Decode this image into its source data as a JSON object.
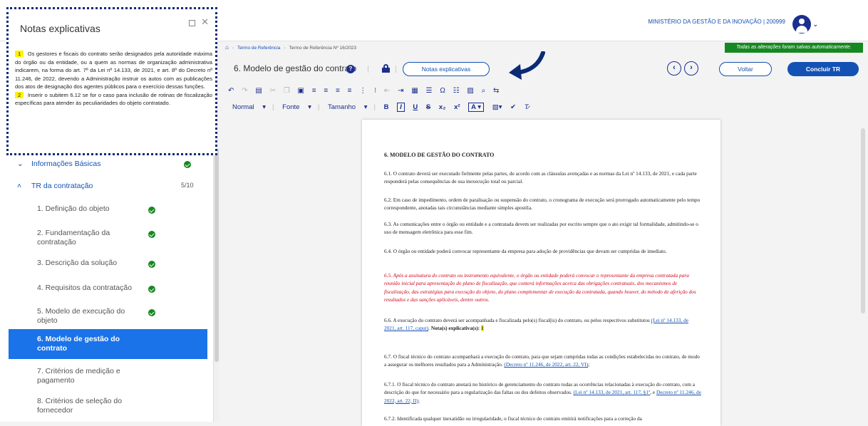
{
  "header": {
    "ministry": "MINISTÉRIO DA GESTÃO E DA INOVAÇÃO | 200999",
    "user_icon": "user-circle-icon"
  },
  "notes_panel": {
    "title": "Notas explicativas",
    "notes": [
      {
        "n": "1",
        "text": "Os gestores e fiscais do contrato serão designados pela autoridade máxima do órgão ou da entidade, ou a quem as normas de organização administrativa indicarem, na forma do art. 7º da Lei nº 14.133, de 2021, e art. 8º do Decreto nº 11.246, de 2022, devendo a Administração instruir os autos com as publicações dos atos de designação dos agentes públicos para o exercício dessas funções."
      },
      {
        "n": "2",
        "text": "Inserir o subitem 6.12 se for o caso para inclusão de rotinas de fiscalização específicas para atender às peculiaridades do objeto contratado."
      }
    ]
  },
  "sidebar": {
    "group_basic": {
      "label": "Informações Básicas"
    },
    "group_tr": {
      "label": "TR da contratação",
      "count": "5/10"
    },
    "items": [
      {
        "label": "1. Definição do objeto"
      },
      {
        "label": "2. Fundamentação da contratação"
      },
      {
        "label": "3. Descrição da solução"
      },
      {
        "label": "4. Requisitos da contratação"
      },
      {
        "label": "5. Modelo de execução do objeto"
      },
      {
        "label": "6. Modelo de gestão do contrato"
      },
      {
        "label": "7. Critérios de medição e pagamento"
      },
      {
        "label": "8. Critérios de seleção do fornecedor"
      }
    ]
  },
  "breadcrumb": {
    "home_icon": "home-icon",
    "crumbs": [
      "Termo de Referência",
      "Termo de Referência Nº 16/2023"
    ]
  },
  "saved_badge": "Todas as alterações foram salvas automaticamente.",
  "section_header": {
    "title": "6. Modelo de gestão do contrato",
    "notes_button": "Notas explicativas",
    "back_button": "Voltar",
    "finish_button": "Concluir TR"
  },
  "editor_toolbar": {
    "format": "Normal",
    "font": "Fonte",
    "size": "Tamanho"
  },
  "document": {
    "heading": "6. MODELO DE GESTÃO DO CONTRATO",
    "p1": "6.1. O contrato deverá ser executado fielmente pelas partes, de acordo com as cláusulas avençadas e as normas da Lei nº 14.133, de 2021, e cada parte responderá pelas consequências de sua inexecução total ou parcial.",
    "p2": "6.2. Em caso de impedimento, ordem de paralisação ou suspensão do contrato, o cronograma de execução será prorrogado automaticamente pelo tempo correspondente, anotadas tais circunstâncias mediante simples apostila.",
    "p3": "6.3. As comunicações entre o órgão ou entidade e a contratada devem ser realizadas por escrito sempre que o ato exigir tal formalidade, admitindo-se o uso de mensagem eletrônica para esse fim.",
    "p4": "6.4. O órgão ou entidade poderá convocar representante da empresa para adoção de providências que devam ser cumpridas de imediato.",
    "p5": "6.5. Após a assinatura do contrato ou instrumento equivalente, o órgão ou entidade poderá convocar o representante da empresa contratada para reunião inicial para apresentação do plano de fiscalização, que conterá informações acerca das obrigações contratuais, dos mecanismos de fiscalização, das estratégias para execução do objeto, do plano complementar de execução da contratada, quando houver, do método de aferição dos resultados e das sanções aplicáveis, dentre outros.",
    "p6_text": "6.6. A execução do contrato deverá ser acompanhada e fiscalizada pelo(s) fiscal(is) do contrato, ou pelos respectivos substitutos",
    "p6_link": "(Lei nº 14.133, de 2021, art. 117, caput)",
    "p6_note": "Nota(s) explicativa(s):",
    "p6_num": "1",
    "p7_text": "6.7. O fiscal técnico do contrato acompanhará a execução do contrato, para que sejam cumpridas todas as condições estabelecidas no contrato, de modo a assegurar os melhores resultados para a Administração.",
    "p7_link": "(Decreto nº 11.246, de 2022, art. 22, VI)",
    "p8_text": "6.7.1. O fiscal técnico do contrato anotará no histórico de gerenciamento do contrato todas as ocorrências relacionadas à execução do contrato, com a descrição do que for necessário para a regularização das faltas ou dos defeitos observados.",
    "p8_link1": "(Lei nº 14.133, de 2021, art. 117, §1º",
    "p8_mid": ", e ",
    "p8_link2": "Decreto nº 11.246, de 2022, art. 22, II)",
    "p9": "6.7.2. Identificada qualquer inexatidão ou irregularidade, o fiscal técnico do contrato emitirá notificações para a correção da"
  }
}
